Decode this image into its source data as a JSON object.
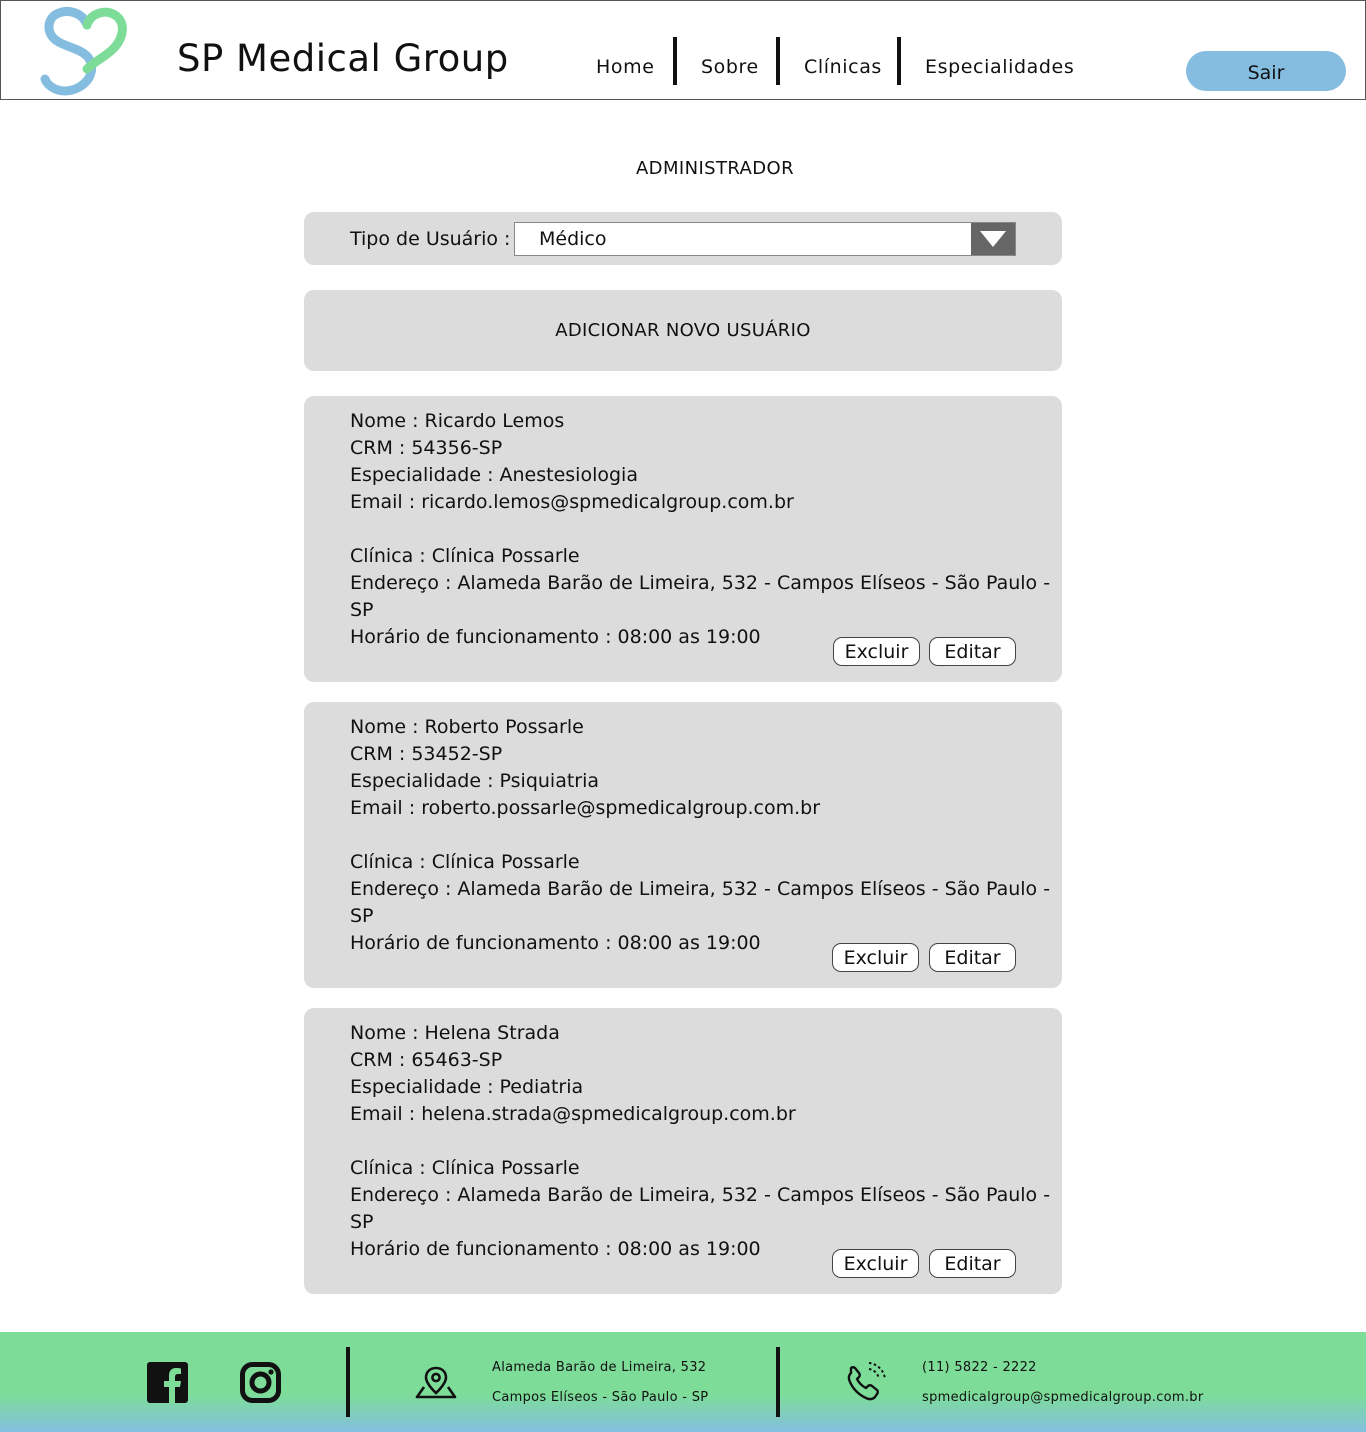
{
  "header": {
    "brand": "SP Medical Group",
    "nav": [
      "Home",
      "Sobre",
      "Clínicas",
      "Especialidades"
    ],
    "logout_label": "Sair",
    "logo_colors": {
      "green": "#7ddd98",
      "blue": "#84bde0"
    }
  },
  "page": {
    "title": "ADMINISTRADOR"
  },
  "filter": {
    "label": "Tipo de Usuário :",
    "selected": "Médico"
  },
  "add_user_label": "ADICIONAR NOVO USUÁRIO",
  "users": [
    {
      "nome": "Nome : Ricardo Lemos",
      "crm": "CRM : 54356-SP",
      "especialidade": "Especialidade : Anestesiologia",
      "email": "Email : ricardo.lemos@spmedicalgroup.com.br",
      "clinica": "Clínica : Clínica Possarle",
      "endereco": "Endereço : Alameda Barão de Limeira, 532 - Campos Elíseos - São Paulo - SP",
      "horario": "Horário de funcionamento : 08:00 as 19:00",
      "delete_label": "Excluir",
      "edit_label": "Editar"
    },
    {
      "nome": "Nome : Roberto Possarle",
      "crm": "CRM : 53452-SP",
      "especialidade": "Especialidade : Psiquiatria",
      "email": "Email : roberto.possarle@spmedicalgroup.com.br",
      "clinica": "Clínica : Clínica Possarle",
      "endereco": "Endereço : Alameda Barão de Limeira, 532 - Campos Elíseos - São Paulo - SP",
      "horario": "Horário de funcionamento : 08:00 as 19:00",
      "delete_label": "Excluir",
      "edit_label": "Editar"
    },
    {
      "nome": "Nome : Helena Strada",
      "crm": "CRM : 65463-SP",
      "especialidade": "Especialidade : Pediatria",
      "email": "Email : helena.strada@spmedicalgroup.com.br",
      "clinica": "Clínica : Clínica Possarle",
      "endereco": "Endereço : Alameda Barão de Limeira, 532 - Campos Elíseos - São Paulo - SP",
      "horario": "Horário de funcionamento : 08:00 as 19:00",
      "delete_label": "Excluir",
      "edit_label": "Editar"
    }
  ],
  "footer": {
    "social_icons": [
      "facebook-icon",
      "instagram-icon"
    ],
    "address_line1": "Alameda Barão de Limeira, 532",
    "address_line2": "Campos Elíseos - São Paulo - SP",
    "phone": "(11) 5822 - 2222",
    "email": "spmedicalgroup@spmedicalgroup.com.br",
    "colors": {
      "top": "#7ddd98",
      "bottom": "#84bfe0"
    }
  }
}
